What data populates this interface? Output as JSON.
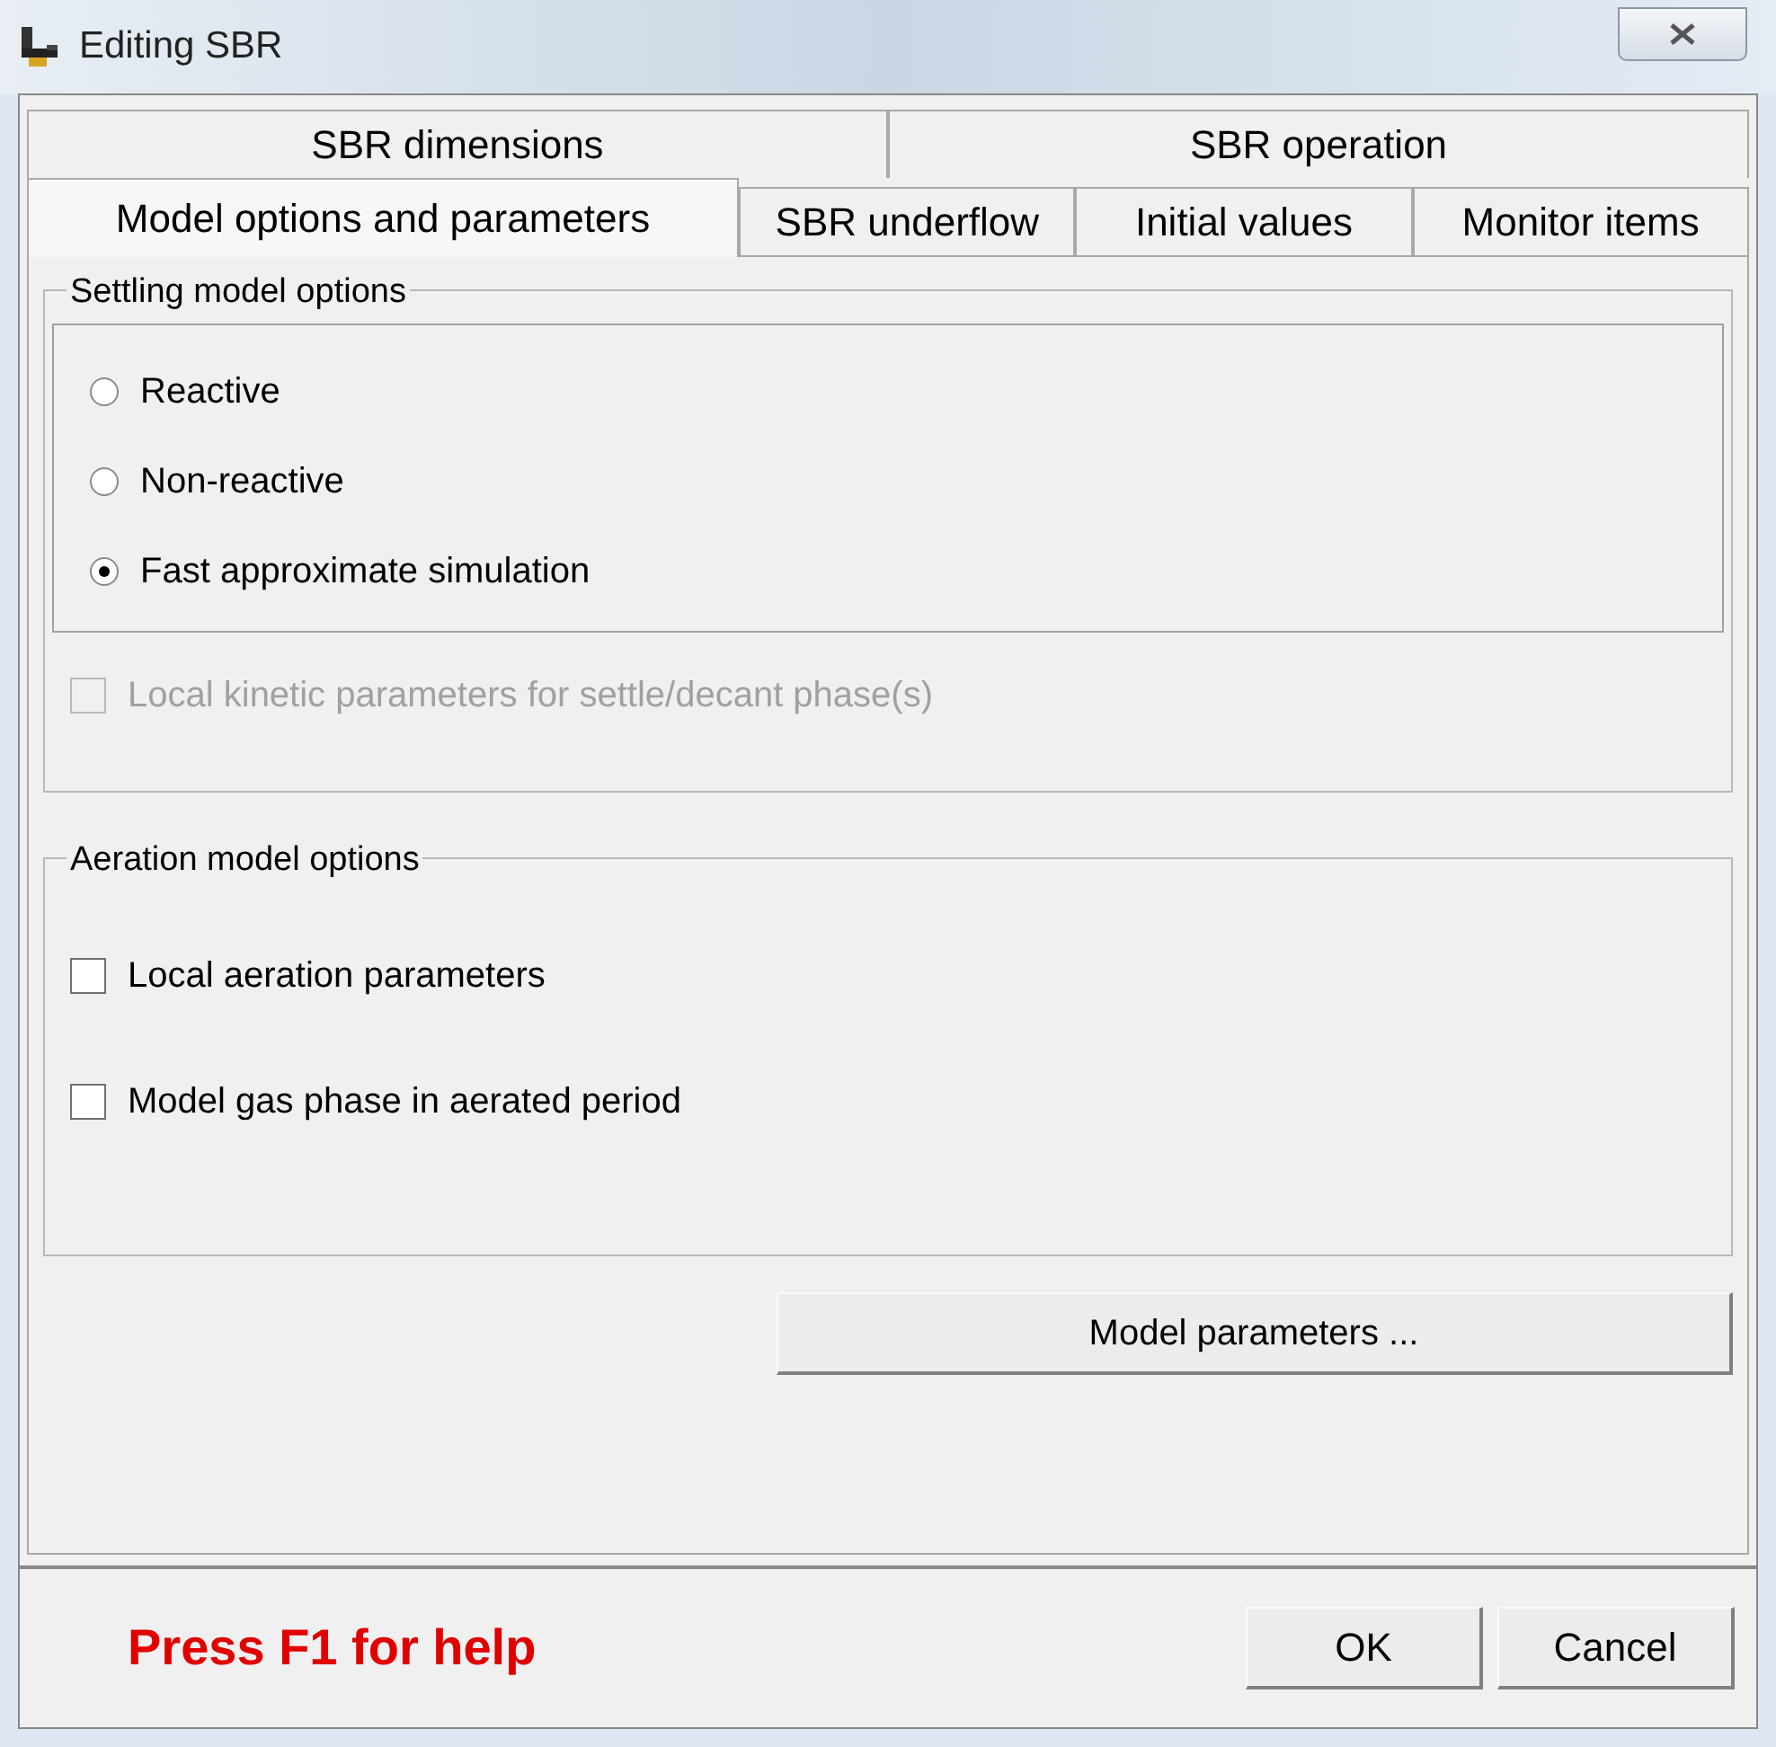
{
  "window": {
    "title": "Editing SBR"
  },
  "tab_rows": [
    [
      {
        "label": "SBR dimensions",
        "selected": false
      },
      {
        "label": "SBR operation",
        "selected": false
      }
    ],
    [
      {
        "label": "Model options and parameters",
        "selected": true
      },
      {
        "label": "SBR underflow",
        "selected": false
      },
      {
        "label": "Initial values",
        "selected": false
      },
      {
        "label": "Monitor items",
        "selected": false
      }
    ]
  ],
  "settling": {
    "title": "Settling model options",
    "options": [
      {
        "label": "Reactive",
        "selected": false
      },
      {
        "label": "Non-reactive",
        "selected": false
      },
      {
        "label": "Fast approximate simulation",
        "selected": true
      }
    ],
    "kinetic": {
      "label": "Local kinetic parameters for settle/decant phase(s)",
      "checked": false,
      "disabled": true
    }
  },
  "aeration": {
    "title": "Aeration model options",
    "options": [
      {
        "label": "Local aeration parameters",
        "checked": false,
        "disabled": false
      },
      {
        "label": "Model gas phase in aerated period",
        "checked": false,
        "disabled": false
      }
    ]
  },
  "model_parameters_button": "Model parameters ...",
  "help_text": "Press F1 for help",
  "buttons": [
    "OK",
    "Cancel"
  ]
}
